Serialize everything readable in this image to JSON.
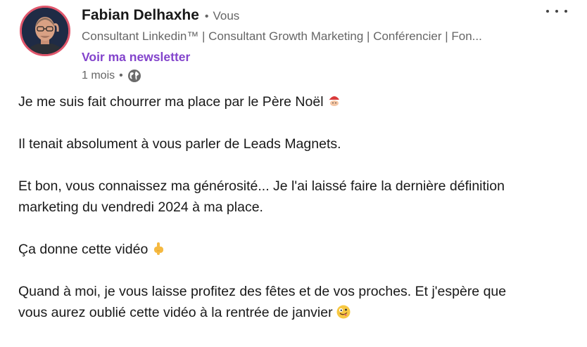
{
  "author": {
    "name": "Fabian Delhaxhe",
    "bullet": "•",
    "degree": "Vous",
    "headline": "Consultant Linkedin™ | Consultant Growth Marketing | Conférencier | Fon...",
    "newsletter_label": "Voir ma newsletter",
    "time": "1 mois",
    "meta_dot": "•",
    "visibility_icon": "globe-icon"
  },
  "menu": {
    "icon": "more-options-icon"
  },
  "post": {
    "p1": "Je me suis fait chourrer ma place par le Père Noël",
    "p1_emoji": "santa-emoji",
    "p2": "Il tenait absolument à vous parler de Leads Magnets.",
    "p3_line1": "Et bon, vous connaissez ma générosité... Je l'ai laissé faire la dernière définition",
    "p3_line2": "marketing du vendredi 2024 à ma place.",
    "p4": "Ça donne cette vidéo",
    "p4_emoji": "point-down-emoji",
    "p5_line1": "Quand à moi, je vous laisse profitez des fêtes et de vos proches. Et j'espère que",
    "p5_line2": "vous aurez oublié cette vidéo à la rentrée de janvier",
    "p5_emoji": "zany-face-emoji"
  }
}
